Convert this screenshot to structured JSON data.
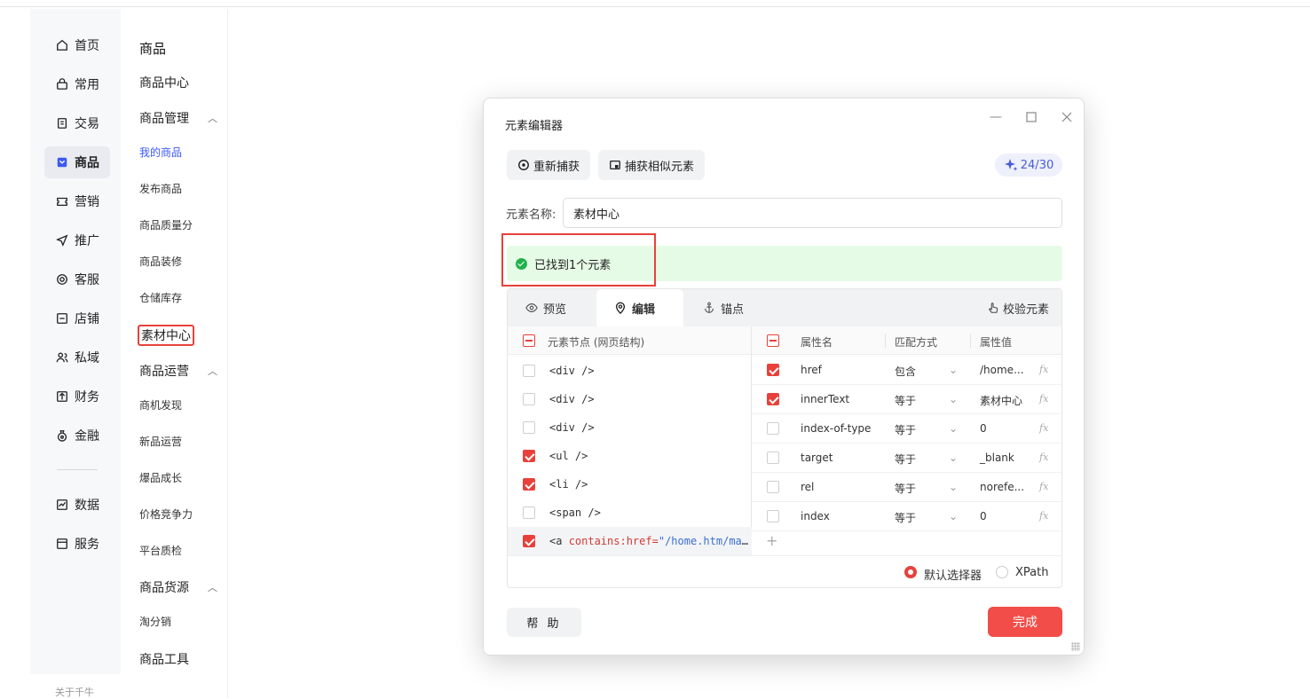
{
  "leftnav": {
    "items": [
      {
        "label": "首页",
        "icon": "home-icon"
      },
      {
        "label": "常用",
        "icon": "bag-icon"
      },
      {
        "label": "交易",
        "icon": "receipt-icon"
      },
      {
        "label": "商品",
        "icon": "goods-icon",
        "active": true
      },
      {
        "label": "营销",
        "icon": "ticket-icon"
      },
      {
        "label": "推广",
        "icon": "send-icon"
      },
      {
        "label": "客服",
        "icon": "headset-icon"
      },
      {
        "label": "店铺",
        "icon": "store-icon"
      },
      {
        "label": "私域",
        "icon": "people-icon"
      },
      {
        "label": "财务",
        "icon": "finance-icon"
      },
      {
        "label": "金融",
        "icon": "moneybag-icon"
      },
      {
        "label": "数据",
        "icon": "chart-icon"
      },
      {
        "label": "服务",
        "icon": "service-icon"
      }
    ],
    "about": "关于千牛"
  },
  "subnav": {
    "title": "商品",
    "center": "商品中心",
    "groups": [
      {
        "label": "商品管理",
        "items": [
          "我的商品",
          "发布商品",
          "商品质量分",
          "商品装修",
          "仓储库存",
          "素材中心"
        ]
      },
      {
        "label": "商品运营",
        "items": [
          "商机发现",
          "新品运营",
          "爆品成长",
          "价格竞争力",
          "平台质检"
        ]
      },
      {
        "label": "商品货源",
        "items": [
          "淘分销"
        ]
      },
      {
        "label": "商品工具",
        "items": []
      }
    ],
    "active_item": "我的商品",
    "boxed_item": "素材中心"
  },
  "dialog": {
    "title": "元素编辑器",
    "recapture_label": "重新捕获",
    "capture_similar_label": "捕获相似元素",
    "quota": "24/30",
    "name_label": "元素名称:",
    "name_value": "素材中心",
    "found_text": "已找到1个元素",
    "tabs": {
      "preview": "预览",
      "edit": "编辑",
      "anchor": "锚点"
    },
    "verify_label": "校验元素",
    "tree_header": "元素节点 (网页结构)",
    "nodes": [
      {
        "text": "<div />",
        "checked": false
      },
      {
        "text": "<div />",
        "checked": false
      },
      {
        "text": "<div />",
        "checked": false
      },
      {
        "text": "<ul />",
        "checked": true
      },
      {
        "text": "<li />",
        "checked": true
      },
      {
        "text": "<span />",
        "checked": false
      }
    ],
    "last_node": {
      "tag": "<a ",
      "attr": "contains:href=",
      "value": "\"/home.htm/materi..."
    },
    "attr_headers": {
      "name": "属性名",
      "match": "匹配方式",
      "value": "属性值"
    },
    "attrs": [
      {
        "name": "href",
        "match": "包含",
        "value": "/home...",
        "checked": true
      },
      {
        "name": "innerText",
        "match": "等于",
        "value": "素材中心",
        "checked": true
      },
      {
        "name": "index-of-type",
        "match": "等于",
        "value": "0",
        "checked": false
      },
      {
        "name": "target",
        "match": "等于",
        "value": "_blank",
        "checked": false
      },
      {
        "name": "rel",
        "match": "等于",
        "value": "norefe...",
        "checked": false
      },
      {
        "name": "index",
        "match": "等于",
        "value": "0",
        "checked": false
      }
    ],
    "fx_label": "fx",
    "selector_default": "默认选择器",
    "selector_xpath": "XPath",
    "help_label": "帮 助",
    "done_label": "完成"
  },
  "colors": {
    "accent": "#f24d48",
    "success_bg": "#e6fbe6",
    "link_blue": "#3b59f5"
  }
}
